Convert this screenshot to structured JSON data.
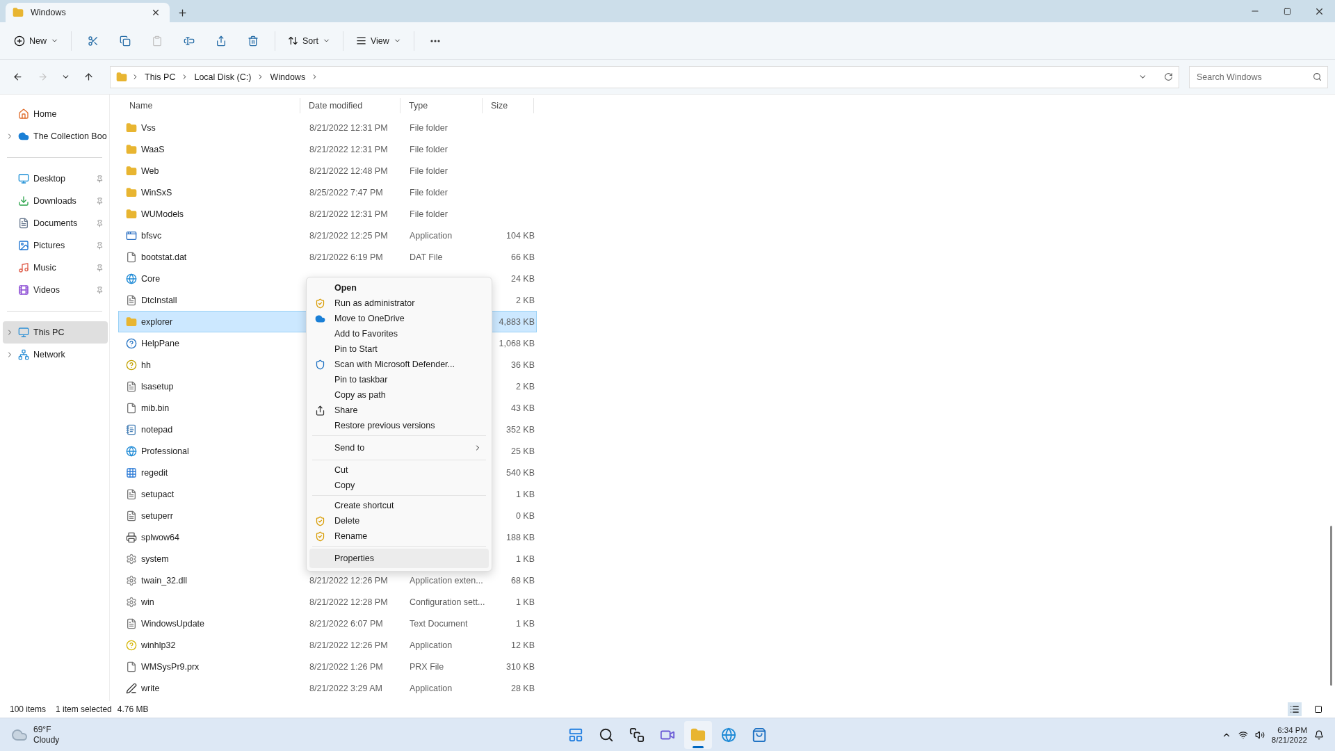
{
  "tab": {
    "title": "Windows",
    "selected": true
  },
  "toolbar": {
    "new_label": "New",
    "icon_buttons": [
      {
        "disabled": false
      },
      {
        "disabled": false
      },
      {
        "disabled": true
      },
      {
        "disabled": false
      },
      {
        "disabled": false
      },
      {
        "disabled": false
      }
    ],
    "sort_label": "Sort",
    "view_label": "View"
  },
  "address": {
    "path": [
      "This PC",
      "Local Disk (C:)",
      "Windows"
    ],
    "search_placeholder": "Search Windows"
  },
  "sidebar": {
    "groups": [
      [
        {
          "label": "Home",
          "kind": "home",
          "selected": false
        },
        {
          "label": "The Collection Boo",
          "kind": "cloud",
          "expanded": false,
          "selected": false
        }
      ],
      [
        {
          "label": "Desktop",
          "kind": "desktop",
          "pinned": true,
          "selected": false
        },
        {
          "label": "Downloads",
          "kind": "downloads",
          "pinned": true,
          "selected": false
        },
        {
          "label": "Documents",
          "kind": "documents",
          "pinned": true,
          "selected": false
        },
        {
          "label": "Pictures",
          "kind": "pictures",
          "pinned": true,
          "selected": false
        },
        {
          "label": "Music",
          "kind": "music",
          "pinned": true,
          "selected": false
        },
        {
          "label": "Videos",
          "kind": "videos",
          "pinned": true,
          "selected": false
        }
      ],
      [
        {
          "label": "This PC",
          "kind": "pc",
          "expanded": false,
          "selected": true
        },
        {
          "label": "Network",
          "kind": "network",
          "expanded": false,
          "selected": false
        }
      ]
    ]
  },
  "table": {
    "columns": [
      "Name",
      "Date modified",
      "Type",
      "Size"
    ],
    "rows": [
      {
        "name": "Vss",
        "kind": "folder",
        "date": "8/21/2022 12:31 PM",
        "type": "File folder",
        "selected": false
      },
      {
        "name": "WaaS",
        "kind": "folder",
        "date": "8/21/2022 12:31 PM",
        "type": "File folder",
        "selected": false
      },
      {
        "name": "Web",
        "kind": "folder",
        "date": "8/21/2022 12:48 PM",
        "type": "File folder",
        "selected": false
      },
      {
        "name": "WinSxS",
        "kind": "folder",
        "date": "8/25/2022 7:47 PM",
        "type": "File folder",
        "selected": false
      },
      {
        "name": "WUModels",
        "kind": "folder",
        "date": "8/21/2022 12:31 PM",
        "type": "File folder",
        "selected": false
      },
      {
        "name": "bfsvc",
        "kind": "app",
        "date": "8/21/2022 12:25 PM",
        "type": "Application",
        "size": "104 KB",
        "selected": false
      },
      {
        "name": "bootstat.dat",
        "kind": "file",
        "date": "8/21/2022 6:19 PM",
        "type": "DAT File",
        "size": "66 KB",
        "selected": false
      },
      {
        "name": "Core",
        "kind": "edge",
        "size": "24 KB",
        "selected": false
      },
      {
        "name": "DtcInstall",
        "kind": "text",
        "size": "2 KB",
        "selected": false
      },
      {
        "name": "explorer",
        "kind": "folder",
        "size": "4,883 KB",
        "selected": true
      },
      {
        "name": "HelpPane",
        "kind": "help",
        "size": "1,068 KB",
        "selected": false
      },
      {
        "name": "hh",
        "kind": "helpdoc",
        "size": "36 KB",
        "selected": false
      },
      {
        "name": "lsasetup",
        "kind": "text",
        "size": "2 KB",
        "selected": false
      },
      {
        "name": "mib.bin",
        "kind": "file",
        "size": "43 KB",
        "selected": false
      },
      {
        "name": "notepad",
        "kind": "notepad",
        "size": "352 KB",
        "selected": false
      },
      {
        "name": "Professional",
        "kind": "edge",
        "size": "25 KB",
        "selected": false
      },
      {
        "name": "regedit",
        "kind": "regedit",
        "size": "540 KB",
        "selected": false
      },
      {
        "name": "setupact",
        "kind": "text",
        "size": "1 KB",
        "selected": false
      },
      {
        "name": "setuperr",
        "kind": "text",
        "size": "0 KB",
        "selected": false
      },
      {
        "name": "splwow64",
        "kind": "printer",
        "size": "188 KB",
        "selected": false
      },
      {
        "name": "system",
        "kind": "settings",
        "size": "1 KB",
        "selected": false
      },
      {
        "name": "twain_32.dll",
        "kind": "settings",
        "date": "8/21/2022 12:26 PM",
        "type": "Application exten...",
        "size": "68 KB",
        "selected": false
      },
      {
        "name": "win",
        "kind": "settings",
        "date": "8/21/2022 12:28 PM",
        "type": "Configuration sett...",
        "size": "1 KB",
        "selected": false
      },
      {
        "name": "WindowsUpdate",
        "kind": "text",
        "date": "8/21/2022 6:07 PM",
        "type": "Text Document",
        "size": "1 KB",
        "selected": false
      },
      {
        "name": "winhlp32",
        "kind": "helpq",
        "date": "8/21/2022 12:26 PM",
        "type": "Application",
        "size": "12 KB",
        "selected": false
      },
      {
        "name": "WMSysPr9.prx",
        "kind": "file",
        "date": "8/21/2022 1:26 PM",
        "type": "PRX File",
        "size": "310 KB",
        "selected": false
      },
      {
        "name": "write",
        "kind": "write",
        "date": "8/21/2022 3:29 AM",
        "type": "Application",
        "size": "28 KB",
        "selected": false
      }
    ]
  },
  "context_menu": {
    "groups": [
      [
        {
          "label": "Open",
          "default": true,
          "kind": "plain",
          "selected": false
        },
        {
          "label": "Run as administrator",
          "kind": "shield",
          "selected": false
        },
        {
          "label": "Move to OneDrive",
          "kind": "cloud",
          "selected": false
        },
        {
          "label": "Add to Favorites",
          "kind": "plain",
          "selected": false
        },
        {
          "label": "Pin to Start",
          "kind": "plain",
          "selected": false
        },
        {
          "label": "Scan with Microsoft Defender...",
          "kind": "defender",
          "selected": false
        },
        {
          "label": "Pin to taskbar",
          "kind": "plain",
          "selected": false
        },
        {
          "label": "Copy as path",
          "kind": "plain",
          "selected": false
        },
        {
          "label": "Share",
          "kind": "share",
          "selected": false
        },
        {
          "label": "Restore previous versions",
          "kind": "plain",
          "selected": false
        }
      ],
      [
        {
          "label": "Send to",
          "kind": "plain",
          "submenu": true,
          "selected": false
        }
      ],
      [
        {
          "label": "Cut",
          "kind": "plain",
          "selected": false
        },
        {
          "label": "Copy",
          "kind": "plain",
          "selected": false
        }
      ],
      [
        {
          "label": "Create shortcut",
          "kind": "plain",
          "selected": false
        },
        {
          "label": "Delete",
          "kind": "shield",
          "selected": false
        },
        {
          "label": "Rename",
          "kind": "shield",
          "selected": false
        }
      ],
      [
        {
          "label": "Properties",
          "kind": "plain",
          "selected": true
        }
      ]
    ]
  },
  "status_bar": {
    "count": "100 items",
    "selection": "1 item selected",
    "selection_size": "4.76 MB",
    "views": [
      {
        "selected": true
      },
      {
        "selected": false
      }
    ]
  },
  "taskbar": {
    "weather": {
      "temp": "69°F",
      "condition": "Cloudy"
    },
    "apps": [
      {
        "selected": false
      },
      {
        "selected": false
      },
      {
        "selected": false
      },
      {
        "selected": false
      },
      {
        "selected": true
      },
      {
        "selected": false
      },
      {
        "selected": false
      }
    ],
    "time": "6:34 PM",
    "date": "8/21/2022"
  }
}
